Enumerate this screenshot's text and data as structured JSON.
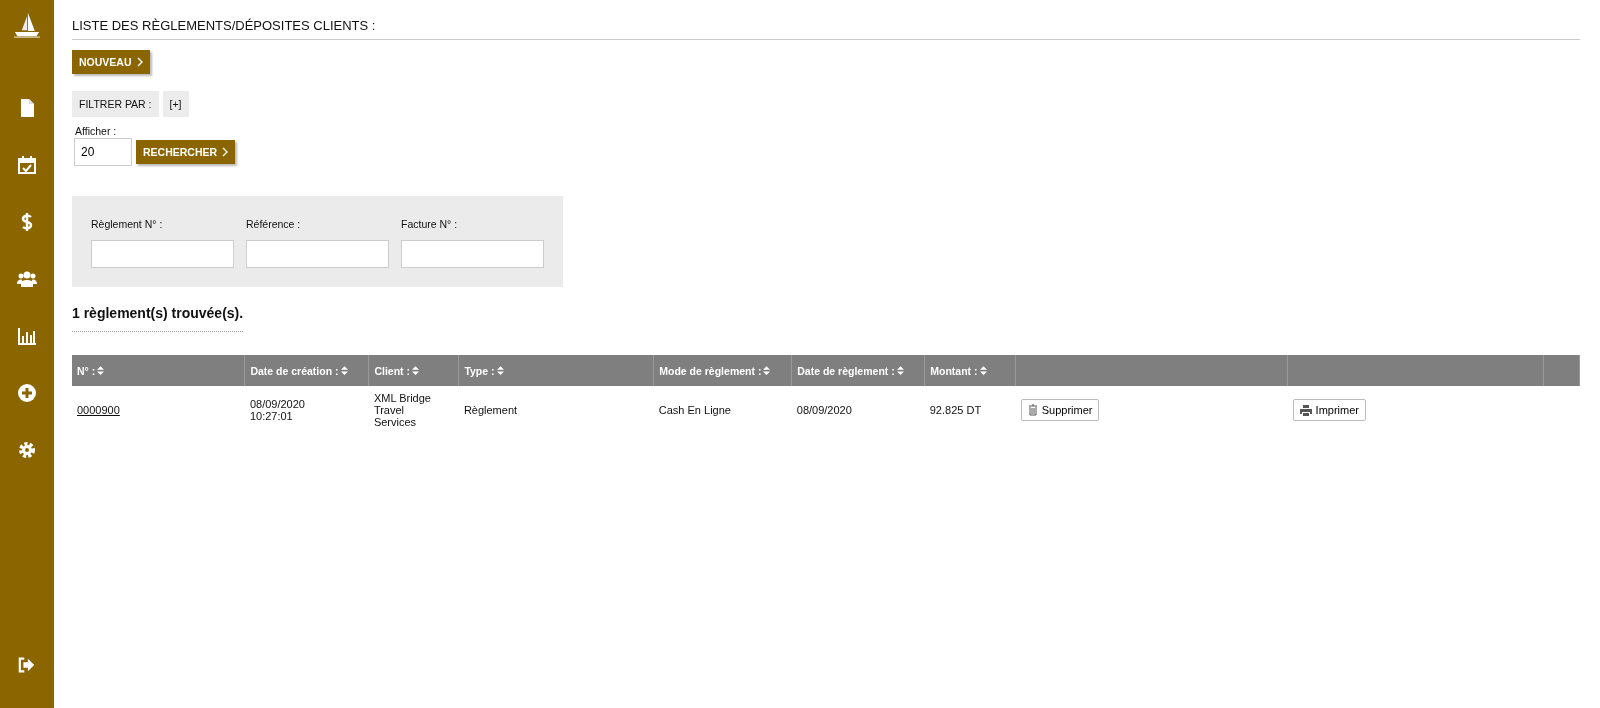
{
  "page_title": "LISTE DES RÈGLEMENTS/DÉPOSITES CLIENTS :",
  "new_button": "NOUVEAU",
  "filter": {
    "label": "FILTRER PAR :",
    "toggle": "[+]"
  },
  "display": {
    "label": "Afficher :",
    "value": "20",
    "search_button": "RECHERCHER"
  },
  "filter_fields": [
    {
      "label": "Règlement N° :"
    },
    {
      "label": "Référence :"
    },
    {
      "label": "Facture N° :"
    }
  ],
  "result_count": "1 règlement(s) trouvée(s).",
  "table": {
    "columns": [
      {
        "label": "N° :",
        "sortable": true
      },
      {
        "label": "Date de création :",
        "sortable": true
      },
      {
        "label": "Client :",
        "sortable": true
      },
      {
        "label": "Type :",
        "sortable": true
      },
      {
        "label": "Mode de règlement :",
        "sortable": true
      },
      {
        "label": "Date de règlement :",
        "sortable": true
      },
      {
        "label": "Montant :",
        "sortable": true
      },
      {
        "sortable": false
      },
      {
        "sortable": false
      },
      {
        "sortable": false
      }
    ],
    "rows": [
      {
        "number": "0000900",
        "created_date": "08/09/2020",
        "created_time": "10:27:01",
        "client": "XML Bridge Travel Services",
        "type": "Règlement",
        "mode": "Cash En Ligne",
        "payment_date": "08/09/2020",
        "amount": "92.825 DT",
        "delete_button": "Supprimer",
        "print_button": "Imprimer"
      }
    ]
  }
}
